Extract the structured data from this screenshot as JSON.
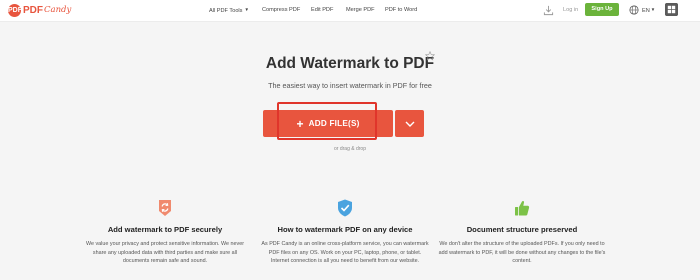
{
  "header": {
    "logo_badge": "PDF",
    "logo_text": "PDF",
    "logo_script": "Candy",
    "nav": [
      "All PDF Tools",
      "Compress PDF",
      "Edit PDF",
      "Merge PDF",
      "PDF to Word"
    ],
    "login_label": "Log in",
    "signup_label": "Sign Up",
    "language": "EN"
  },
  "hero": {
    "title": "Add Watermark to PDF",
    "subtitle": "The easiest way to insert watermark in PDF for free",
    "add_files_label": "ADD FILE(S)",
    "drag_drop": "or drag & drop"
  },
  "features": [
    {
      "icon": "refresh-shield-icon",
      "title": "Add watermark to PDF securely",
      "text": "We value your privacy and protect sensitive information. We never share any uploaded data with third parties and make sure all documents remain safe and sound."
    },
    {
      "icon": "shield-check-icon",
      "title": "How to watermark PDF on any device",
      "text": "As PDF Candy is an online cross-platform service, you can watermark PDF files on any OS. Work on your PC, laptop, phone, or tablet. Internet connection is all you need to benefit from our website."
    },
    {
      "icon": "thumbs-up-icon",
      "title": "Document structure preserved",
      "text": "We don't alter the structure of the uploaded PDFs. If you only need to add watermark to PDF, it will be done without any changes to the file's content."
    }
  ],
  "colors": {
    "brand": "#e8553e",
    "signup": "#6bb33b",
    "highlight": "#e0352b",
    "background": "#f5f5f5"
  }
}
